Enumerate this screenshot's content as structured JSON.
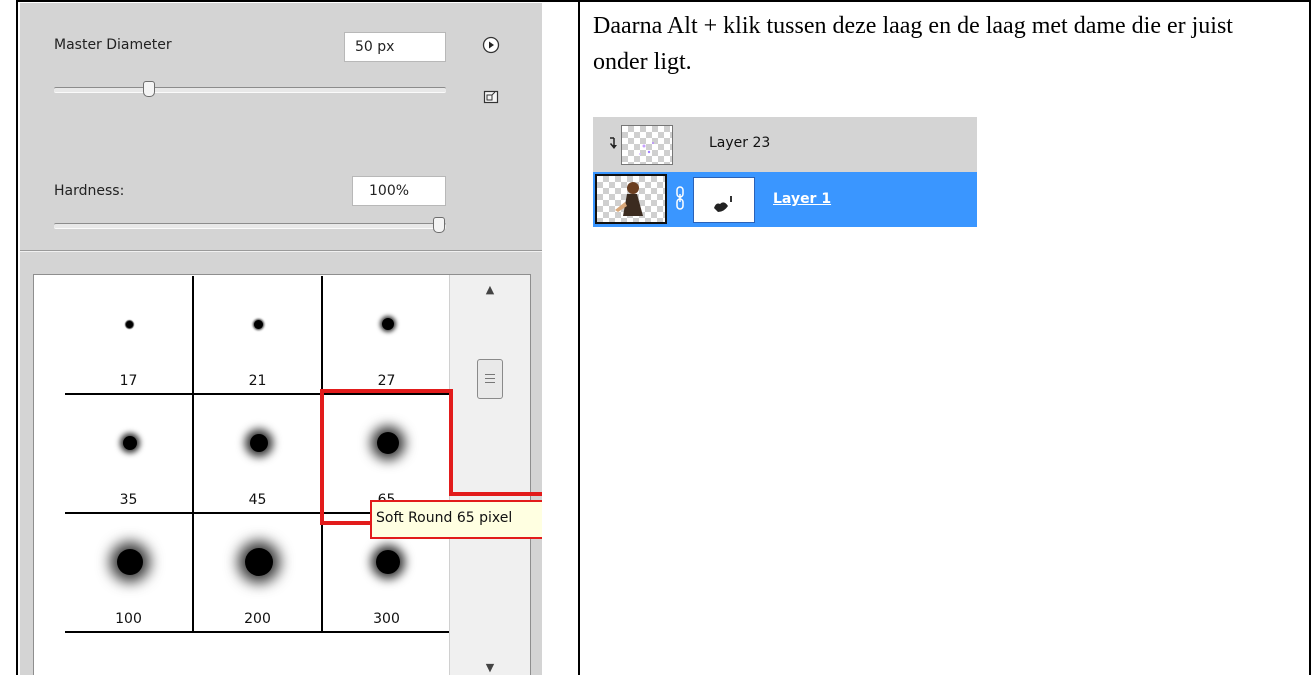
{
  "brush_panel": {
    "master_diameter": {
      "label": "Master Diameter",
      "value": "50 px"
    },
    "hardness": {
      "label": "Hardness:",
      "value": "100%"
    },
    "presets": [
      {
        "size": "17",
        "diameter": 7,
        "blur": 1
      },
      {
        "size": "21",
        "diameter": 9,
        "blur": 2
      },
      {
        "size": "27",
        "diameter": 12,
        "blur": 4
      },
      {
        "size": "35",
        "diameter": 14,
        "blur": 6
      },
      {
        "size": "45",
        "diameter": 18,
        "blur": 9
      },
      {
        "size": "65",
        "diameter": 22,
        "blur": 12
      },
      {
        "size": "100",
        "diameter": 26,
        "blur": 14
      },
      {
        "size": "200",
        "diameter": 28,
        "blur": 14
      },
      {
        "size": "300",
        "diameter": 24,
        "blur": 10
      }
    ],
    "selected_preset": "65",
    "tooltip": "Soft Round 65 pixel"
  },
  "instruction": "Daarna Alt + klik tussen deze laag en de laag met dame die er juist onder ligt.",
  "layers": [
    {
      "name": "Layer 23",
      "selected": false,
      "clipped": true
    },
    {
      "name": "Layer 1",
      "selected": true,
      "clipped": false
    }
  ],
  "colors": {
    "panel": "#d4d4d4",
    "selection": "#3a96ff",
    "highlight": "#e21b1b",
    "tooltip_bg": "#ffffe1"
  }
}
